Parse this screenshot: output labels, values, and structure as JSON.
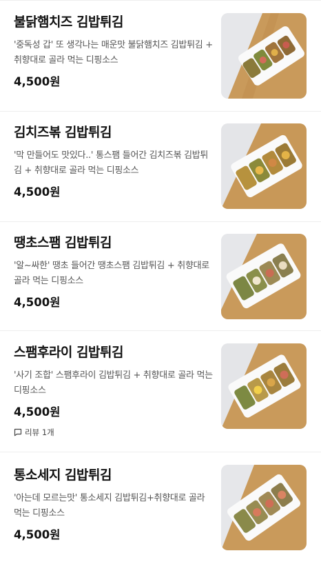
{
  "menu_items": [
    {
      "title": "불닭햄치즈 김밥튀김",
      "description": "'중독성 갑' 또 생각나는 매운맛 불닭햄치즈 김밥튀김 + 취향대로 골라 먹는 디핑소스",
      "price": "4,500원",
      "review": ""
    },
    {
      "title": "김치즈볶 김밥튀김",
      "description": "'막 만들어도 맛있다..' 통스팸 들어간 김치즈볶 김밥튀김 + 취향대로 골라 먹는 디핑소스",
      "price": "4,500원",
      "review": ""
    },
    {
      "title": "땡초스팸 김밥튀김",
      "description": "'알~싸한' 땡초 들어간 땡초스팸 김밥튀김 + 취향대로 골라 먹는 디핑소스",
      "price": "4,500원",
      "review": ""
    },
    {
      "title": "스팸후라이 김밥튀김",
      "description": "'사기 조합' 스팸후라이 김밥튀김 + 취향대로 골라 먹는 디핑소스",
      "price": "4,500원",
      "review": "리뷰 1개"
    },
    {
      "title": "통소세지 김밥튀김",
      "description": "'아는데 모르는맛' 통소세지 김밥튀김+취향대로 골라 먹는 디핑소스",
      "price": "4,500원",
      "review": ""
    }
  ],
  "icons": {
    "review_icon": "speech-bubble-icon"
  },
  "colors": {
    "text_primary": "#111111",
    "text_secondary": "#555555",
    "divider": "#eeeeee",
    "board_wood": "#c99a5b",
    "plate": "#ffffff"
  }
}
